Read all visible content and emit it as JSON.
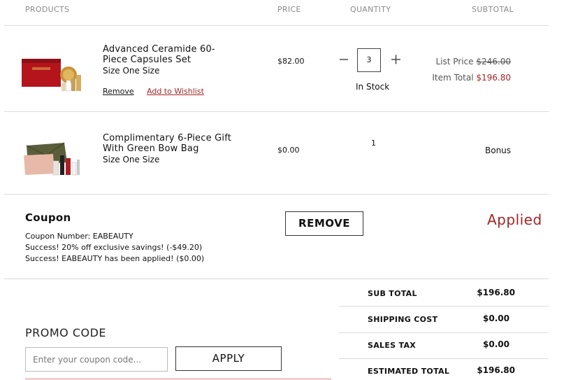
{
  "headers": {
    "products": "PRODUCTS",
    "price": "PRICE",
    "quantity": "QUANTITY",
    "subtotal": "SUBTOTAL"
  },
  "items": [
    {
      "name_line1": "Advanced Ceramide 60-",
      "name_line2": "Piece Capsules Set",
      "size": "Size One Size",
      "remove_label": "Remove",
      "wishlist_label": "Add to Wishlist",
      "price": "$82.00",
      "quantity": "3",
      "stock": "In Stock",
      "list_price_label": "List Price",
      "list_price": "$246.00",
      "item_total_label": "Item Total",
      "item_total": "$196.80"
    },
    {
      "name_line1": "Complimentary 6-Piece Gift",
      "name_line2": "With Green Bow Bag",
      "size": "Size One Size",
      "price": "$0.00",
      "quantity": "1",
      "subtotal": "Bonus"
    }
  ],
  "coupon": {
    "title": "Coupon",
    "number_line": "Coupon Number: EABEAUTY",
    "success_line1": "Success! 20% off exclusive savings! (-$49.20)",
    "success_line2": "Success! EABEAUTY has been applied! ($0.00)",
    "remove_label": "REMOVE",
    "status": "Applied"
  },
  "promo": {
    "title": "PROMO CODE",
    "placeholder": "Enter your coupon code...",
    "apply_label": "APPLY"
  },
  "summary": [
    {
      "label": "SUB TOTAL",
      "value": "$196.80"
    },
    {
      "label": "SHIPPING COST",
      "value": "$0.00"
    },
    {
      "label": "SALES TAX",
      "value": "$0.00"
    },
    {
      "label": "ESTIMATED TOTAL",
      "value": "$196.80"
    }
  ],
  "colors": {
    "accent_red": "#a32626",
    "rule": "#dcdcdc",
    "pink_bar": "#f0cfcf"
  },
  "icons": [
    "minus-icon",
    "plus-icon"
  ]
}
